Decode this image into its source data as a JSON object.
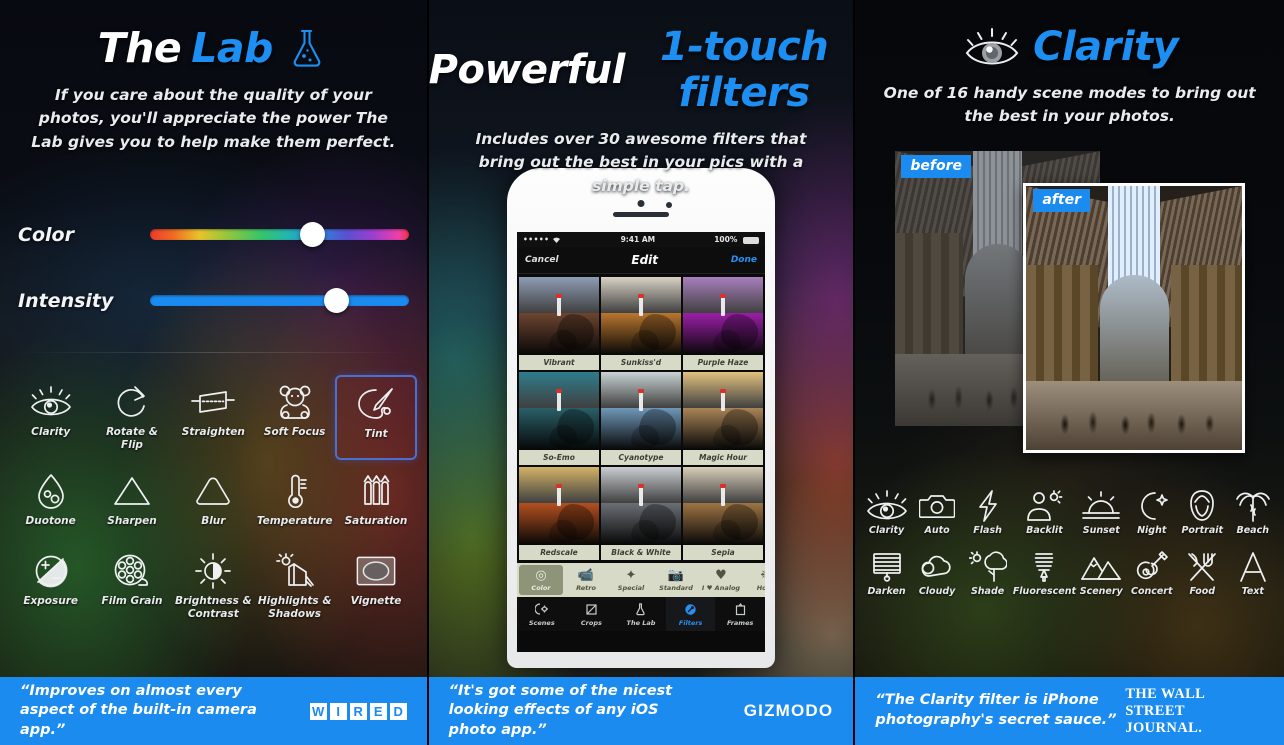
{
  "panel1": {
    "title_white": "The",
    "title_blue": "Lab",
    "title_icon": "flask-icon",
    "subtitle": "If you care about the quality of your photos, you'll appreciate the power The Lab gives you to help make them perfect.",
    "sliders": [
      {
        "label": "Color",
        "type": "rainbow",
        "value": 63
      },
      {
        "label": "Intensity",
        "type": "plain",
        "value": 72
      }
    ],
    "tools": [
      {
        "label": "Clarity",
        "icon": "eye-icon",
        "selected": false
      },
      {
        "label": "Rotate & Flip",
        "icon": "rotate-arrow-icon",
        "selected": false
      },
      {
        "label": "Straighten",
        "icon": "straighten-icon",
        "selected": false
      },
      {
        "label": "Soft Focus",
        "icon": "teddy-bear-icon",
        "selected": false
      },
      {
        "label": "Tint",
        "icon": "palette-brush-icon",
        "selected": true
      },
      {
        "label": "Duotone",
        "icon": "droplet-icon",
        "selected": false
      },
      {
        "label": "Sharpen",
        "icon": "triangle-sharp-icon",
        "selected": false
      },
      {
        "label": "Blur",
        "icon": "triangle-round-icon",
        "selected": false
      },
      {
        "label": "Temperature",
        "icon": "thermometer-icon",
        "selected": false
      },
      {
        "label": "Saturation",
        "icon": "crayons-icon",
        "selected": false
      },
      {
        "label": "Exposure",
        "icon": "exposure-icon",
        "selected": false
      },
      {
        "label": "Film Grain",
        "icon": "film-reel-icon",
        "selected": false
      },
      {
        "label": "Brightness & Contrast",
        "icon": "sun-contrast-icon",
        "selected": false
      },
      {
        "label": "Highlights & Shadows",
        "icon": "house-sun-icon",
        "selected": false
      },
      {
        "label": "Vignette",
        "icon": "vignette-icon",
        "selected": false
      }
    ],
    "quote": {
      "text": "“Improves on almost every aspect of the built-in camera app.”",
      "brand": "WIRED",
      "brand_letters": [
        "W",
        "I",
        "R",
        "E",
        "D"
      ]
    }
  },
  "panel2": {
    "title_white": "Powerful",
    "title_blue": "1-touch filters",
    "subtitle": "Includes over 30 awesome filters that bring out the best in your pics with a simple tap.",
    "phone": {
      "status": {
        "signal": "•••••",
        "wifi": "wifi-icon",
        "time": "9:41 AM",
        "battery_pct": "100%"
      },
      "nav": {
        "left": "Cancel",
        "title": "Edit",
        "right": "Done"
      },
      "filters": [
        {
          "label": "Vibrant",
          "sky": "#8e9cb4",
          "ground": "#6d4530"
        },
        {
          "label": "Sunkiss'd",
          "sky": "#d9d2c4",
          "ground": "#b9762f"
        },
        {
          "label": "Purple Haze",
          "sky": "#a87fbd",
          "ground": "#9b1fa8"
        },
        {
          "label": "So-Emo",
          "sky": "#2e7d8c",
          "ground": "#2a5f68"
        },
        {
          "label": "Cyanotype",
          "sky": "#c8d3d2",
          "ground": "#6f97b8"
        },
        {
          "label": "Magic Hour",
          "sky": "#e2c07e",
          "ground": "#a98457"
        },
        {
          "label": "Redscale",
          "sky": "#d2b266",
          "ground": "#b4501f"
        },
        {
          "label": "Black & White",
          "sky": "#c9cdd1",
          "ground": "#6b7075"
        },
        {
          "label": "Sepia",
          "sky": "#d8cdb8",
          "ground": "#9d7444"
        }
      ],
      "categories": [
        {
          "label": "Color",
          "icon": "color-circles-icon",
          "selected": true
        },
        {
          "label": "Retro",
          "icon": "retro-camera-icon",
          "selected": false
        },
        {
          "label": "Special",
          "icon": "magic-wand-icon",
          "selected": false
        },
        {
          "label": "Standard",
          "icon": "camera-icon",
          "selected": false
        },
        {
          "label": "I ♥ Analog",
          "icon": "analog-icon",
          "selected": false
        },
        {
          "label": "Holly",
          "icon": "holly-icon",
          "selected": false
        }
      ],
      "tabs": [
        {
          "label": "Scenes",
          "icon": "scenes-icon",
          "selected": false
        },
        {
          "label": "Crops",
          "icon": "crop-icon",
          "selected": false
        },
        {
          "label": "The Lab",
          "icon": "flask-icon",
          "selected": false
        },
        {
          "label": "Filters",
          "icon": "filters-icon",
          "selected": true
        },
        {
          "label": "Frames",
          "icon": "frame-icon",
          "selected": false
        }
      ]
    },
    "quote": {
      "text": "“It's got some of the nicest looking effects of any iOS photo app.”",
      "brand": "GIZMODO"
    }
  },
  "panel3": {
    "title_icon": "eye-icon",
    "title_blue": "Clarity",
    "subtitle": "One of 16 handy scene modes to bring out the best in your photos.",
    "badges": {
      "before": "before",
      "after": "after"
    },
    "scenes": [
      {
        "label": "Clarity",
        "icon": "eye-icon"
      },
      {
        "label": "Auto",
        "icon": "camera-icon"
      },
      {
        "label": "Flash",
        "icon": "bolt-icon"
      },
      {
        "label": "Backlit",
        "icon": "backlit-person-icon"
      },
      {
        "label": "Sunset",
        "icon": "sunset-icon"
      },
      {
        "label": "Night",
        "icon": "moon-star-icon"
      },
      {
        "label": "Portrait",
        "icon": "portrait-icon"
      },
      {
        "label": "Beach",
        "icon": "palm-tree-icon"
      },
      {
        "label": "Darken",
        "icon": "blinds-icon"
      },
      {
        "label": "Cloudy",
        "icon": "cloud-icon"
      },
      {
        "label": "Shade",
        "icon": "tree-sun-icon"
      },
      {
        "label": "Fluorescent",
        "icon": "bulb-icon"
      },
      {
        "label": "Scenery",
        "icon": "mountains-icon"
      },
      {
        "label": "Concert",
        "icon": "guitar-icon"
      },
      {
        "label": "Food",
        "icon": "cutlery-icon"
      },
      {
        "label": "Text",
        "icon": "letter-a-icon"
      }
    ],
    "quote": {
      "text": "“The Clarity filter is iPhone photography's secret sauce.”",
      "brand": "THE WALL STREET JOURNAL."
    }
  },
  "colors": {
    "accent_blue": "#1b8bf0",
    "quote_bar": "#1b8bf0",
    "text_white": "#ffffff",
    "selected_border": "#4a6fd0"
  }
}
